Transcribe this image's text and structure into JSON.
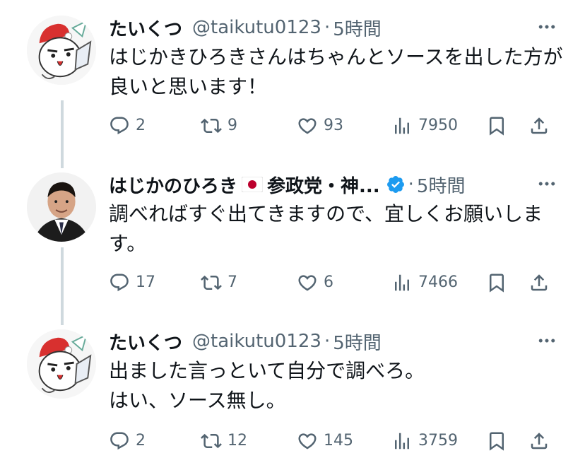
{
  "tweets": [
    {
      "name": "たいくつ",
      "handle": "@taikutu0123",
      "dot": "·",
      "time": "5時間",
      "text": "はじかきひろきさんはちゃんとソースを出した方が良いと思います！",
      "replies": "2",
      "retweets": "9",
      "likes": "93",
      "views": "7950"
    },
    {
      "name": "はじかのひろき",
      "name_suffix": "参政党・神...",
      "dot": "·",
      "time": "5時間",
      "text": "調べればすぐ出てきますので、宜しくお願いします。",
      "replies": "17",
      "retweets": "7",
      "likes": "6",
      "views": "7466"
    },
    {
      "name": "たいくつ",
      "handle": "@taikutu0123",
      "dot": "·",
      "time": "5時間",
      "text": "出ました言っといて自分で調べろ。\nはい、ソース無し。",
      "replies": "2",
      "retweets": "12",
      "likes": "145",
      "views": "3759"
    }
  ],
  "icons": {
    "reply": "reply-icon",
    "retweet": "retweet-icon",
    "like": "heart-icon",
    "views": "views-icon",
    "bookmark": "bookmark-icon",
    "share": "share-icon",
    "more": "more-icon",
    "flag": "japan-flag-icon",
    "verified": "verified-icon"
  },
  "colors": {
    "text": "#0f1419",
    "secondary": "#536471",
    "verified": "#1d9bf0",
    "thread_line": "#cfd9de"
  }
}
